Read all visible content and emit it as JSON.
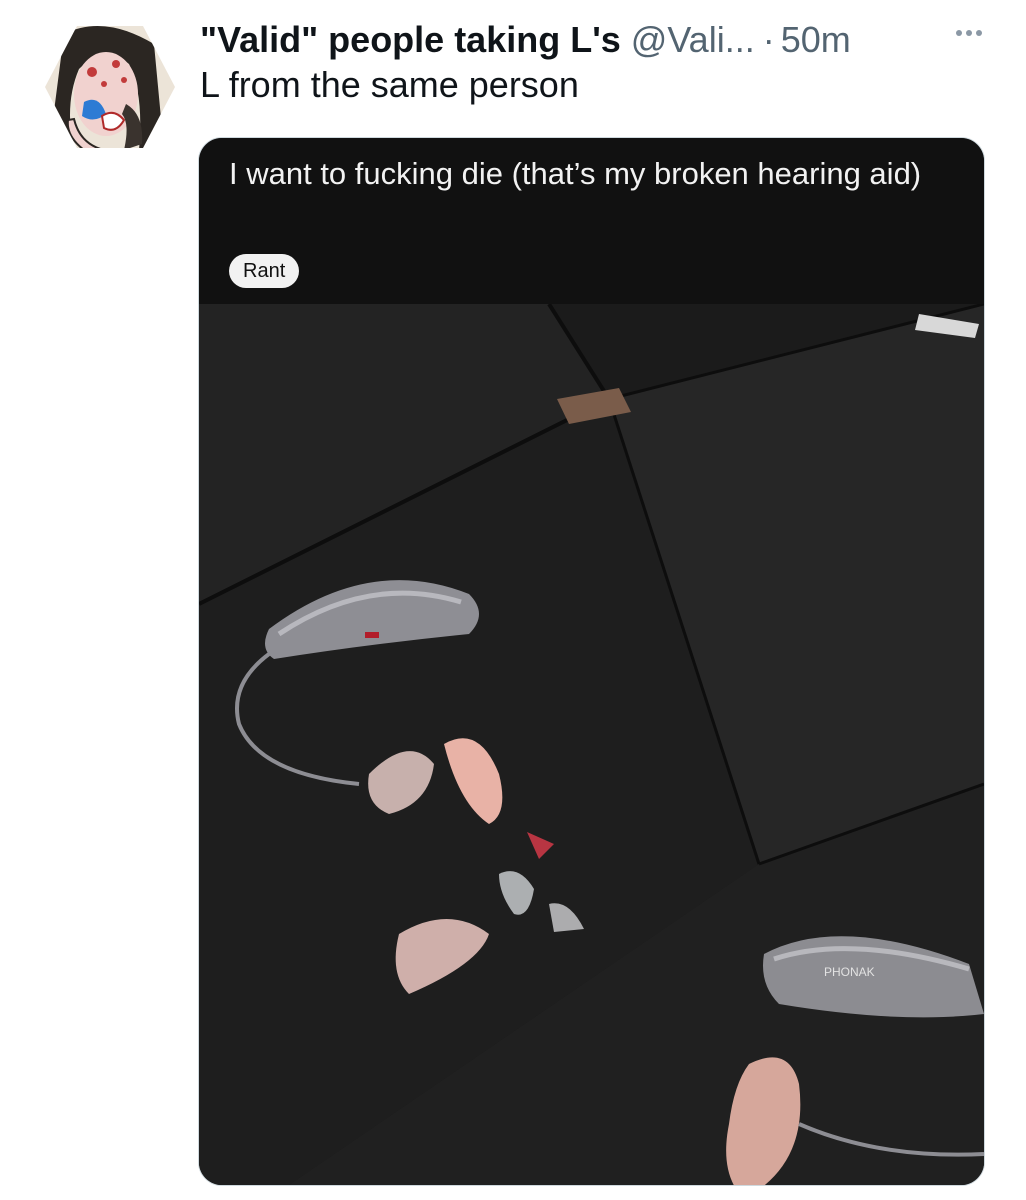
{
  "tweet": {
    "display_name": "\"Valid\" people taking L's",
    "handle": "@Vali...",
    "separator": "·",
    "time": "50m",
    "text": "L from the same person"
  },
  "embedded_post": {
    "title": "I want to fucking die (that’s my broken hearing aid)",
    "flair": "Rant"
  },
  "photo": {
    "brand_text": "PHONAK"
  },
  "icons": {
    "more": "more-horizontal-icon",
    "avatar": "cartoon-avatar"
  },
  "colors": {
    "text": "#0f1419",
    "secondary": "#536471",
    "post_bg": "#111111",
    "flair_bg": "#f2f2f2"
  }
}
